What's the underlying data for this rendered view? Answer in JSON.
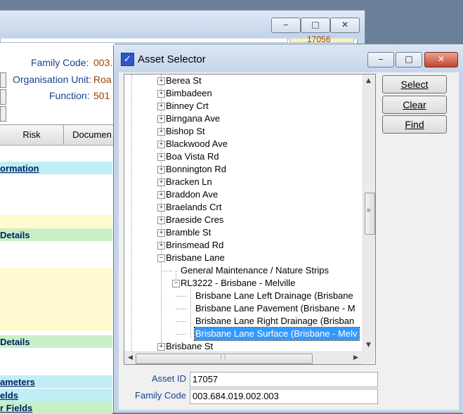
{
  "bg_window": {
    "window_buttons": [
      "‒",
      "□",
      "✕"
    ],
    "family_code_label": "Family Code:",
    "family_code_value": "003.",
    "top_right_value": "17056",
    "org_unit_label": "Organisation Unit:",
    "org_unit_value": "Roa",
    "function_label": "Function:",
    "function_value": "501",
    "tabs": [
      "Risk",
      "Documen"
    ],
    "sections": [
      "ormation",
      "Details",
      "Details",
      "ameters",
      "elds",
      "r Fields"
    ]
  },
  "dialog": {
    "title": "Asset Selector",
    "window_buttons": [
      "‒",
      "□",
      "✕"
    ],
    "tree": {
      "items": [
        {
          "label": "Berea St"
        },
        {
          "label": "Bimbadeen"
        },
        {
          "label": "Binney Crt"
        },
        {
          "label": "Birngana Ave"
        },
        {
          "label": "Bishop St"
        },
        {
          "label": "Blackwood Ave"
        },
        {
          "label": "Boa Vista Rd"
        },
        {
          "label": "Bonnington Rd"
        },
        {
          "label": "Bracken Ln"
        },
        {
          "label": "Braddon Ave"
        },
        {
          "label": "Braelands Crt"
        },
        {
          "label": "Braeside Cres"
        },
        {
          "label": "Bramble St"
        },
        {
          "label": "Brinsmead Rd"
        },
        {
          "label": "Brisbane Lane"
        },
        {
          "label": "General Maintenance / Nature Strips"
        },
        {
          "label": "RL3222 - Brisbane - Melville"
        },
        {
          "label": "Brisbane Lane Left Drainage (Brisbane"
        },
        {
          "label": "Brisbane Lane Pavement (Brisbane - M"
        },
        {
          "label": "Brisbane Lane Right Drainage (Brisban"
        },
        {
          "label": "Brisbane Lane Surface (Brisbane - Melv"
        },
        {
          "label": "Brisbane St"
        }
      ],
      "selected_index": 20
    },
    "buttons": {
      "select": "Select",
      "clear": "Clear",
      "find": "Find"
    },
    "asset_id_label": "Asset ID",
    "asset_id_value": "17057",
    "family_code_label": "Family Code",
    "family_code_value": "003.684.019.002.003"
  }
}
